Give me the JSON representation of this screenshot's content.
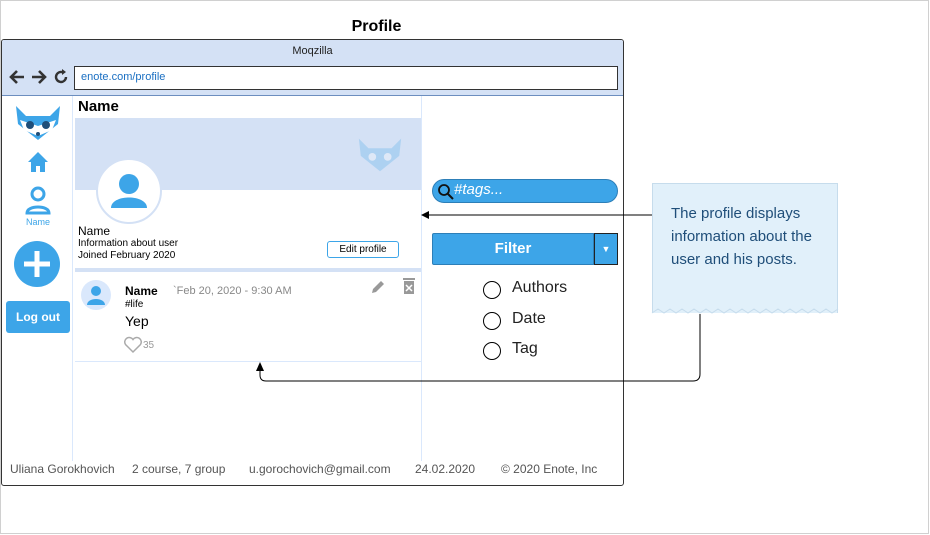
{
  "page": {
    "title": "Profile"
  },
  "browser": {
    "window_title": "Moqzilla",
    "url": "enote.com/profile",
    "back_icon": "arrow-left-icon",
    "forward_icon": "arrow-right-icon",
    "reload_icon": "reload-icon"
  },
  "sidebar": {
    "logo_icon": "raccoon-logo-icon",
    "home_icon": "home-icon",
    "profile_label": "Name",
    "add_icon": "plus-icon",
    "logout_label": "Log out"
  },
  "profile": {
    "heading": "Name",
    "name": "Name",
    "info": "Information about user",
    "joined": "Joined February 2020",
    "edit_label": "Edit profile"
  },
  "post": {
    "author": "Name",
    "date": "`Feb 20, 2020 - 9:30 AM",
    "tag": "#life",
    "text": "Yep",
    "likes": "35"
  },
  "footer": {
    "author": "Uliana Gorokhovich",
    "course": "2 course, 7 group",
    "email": "u.gorochovich@gmail.com",
    "date": "24.02.2020",
    "copyright": "© 2020 Enote, Inc"
  },
  "search": {
    "placeholder": "#tags..."
  },
  "filter": {
    "label": "Filter",
    "options": [
      "Authors",
      "Date",
      "Tag"
    ]
  },
  "note": {
    "text": "The profile displays information about the user and his posts."
  },
  "colors": {
    "accent": "#3da5e8",
    "titlebar": "#d4e1f5",
    "note_bg": "#e1f0fa",
    "note_text": "#1f4e79"
  }
}
